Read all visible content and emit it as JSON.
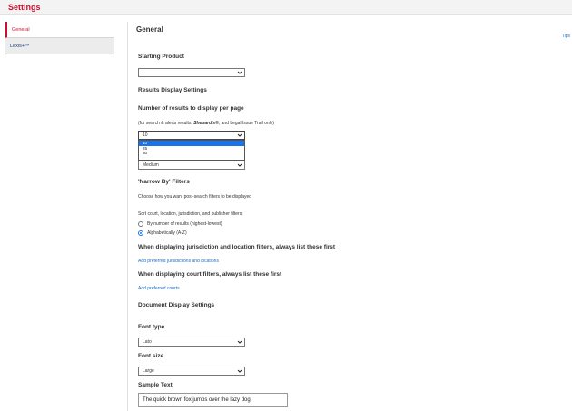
{
  "app": {
    "title": "Settings"
  },
  "sidebar": {
    "items": [
      {
        "label": "General"
      },
      {
        "label": "Lexis+™"
      }
    ]
  },
  "main": {
    "title": "General",
    "tips": "Tips",
    "starting_product": {
      "label": "Starting Product",
      "value": ""
    },
    "results_display": {
      "heading": "Results Display Settings",
      "per_page_label": "Number of results to display per page",
      "per_page_note_prefix": "(for search & alerts results, ",
      "per_page_note_italic": "Shepard's®",
      "per_page_note_suffix": ", and Legal Issue Trail only)",
      "per_page_value": "10",
      "per_page_options": [
        "10",
        "25",
        "50"
      ],
      "second_select_value": "Medium"
    },
    "narrow_by": {
      "heading": "'Narrow By' Filters",
      "desc": "Choose how you want post-search filters to be displayed",
      "sort_label": "Sort court, location, jurisdiction, and publisher filters:",
      "options": [
        {
          "label": "By number of results (highest-lowest)",
          "checked": false
        },
        {
          "label": "Alphabetically (A-Z)",
          "checked": true
        }
      ]
    },
    "jurisdiction": {
      "heading": "When displaying jurisdiction and location filters, always list these first",
      "link": "Add preferred jurisdictions and locations"
    },
    "court": {
      "heading": "When displaying court filters, always list these first",
      "link": "Add preferred courts"
    },
    "document_display": {
      "heading": "Document Display Settings",
      "font_type_label": "Font type",
      "font_type_value": "Lato",
      "font_size_label": "Font size",
      "font_size_value": "Large",
      "sample_label": "Sample Text",
      "sample_text": "The quick brown fox jumps over the lazy dog."
    }
  },
  "colors": {
    "brand": "#c8102e",
    "link": "#1d6fc4",
    "selection": "#1a73e8"
  },
  "icons": {
    "select_arrow": "chevron-down-icon"
  }
}
